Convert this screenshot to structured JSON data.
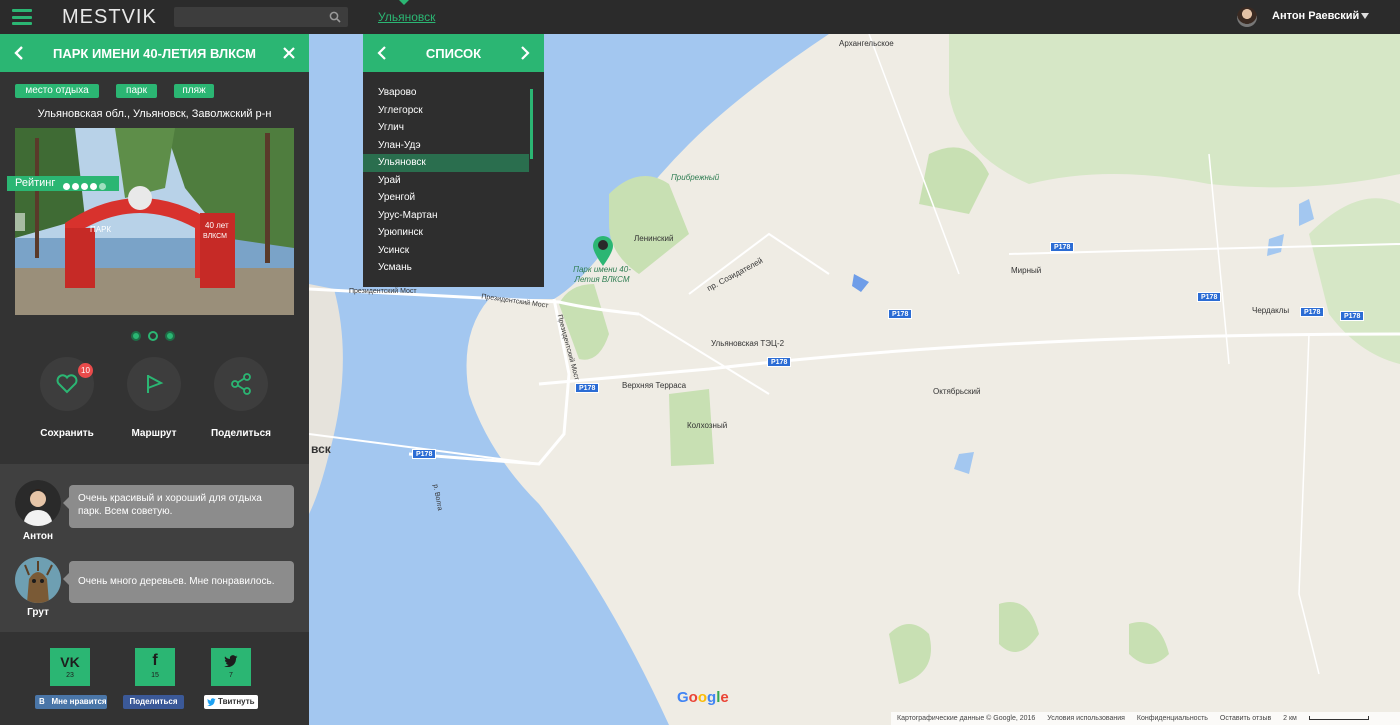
{
  "topbar": {
    "logo_left": "MEST",
    "logo_pin": "O",
    "logo_right": "VIK",
    "search_placeholder": "",
    "city": "Ульяновск",
    "user_name": "Антон Раевский"
  },
  "place": {
    "title": "ПАРК ИМЕНИ 40-ЛЕТИЯ ВЛКСМ",
    "tags": [
      "место отдыха",
      "парк",
      "пляж"
    ],
    "address": "Ульяновская обл., Ульяновск, Заволжский р-н",
    "rating_label": "Рейтинг",
    "rating_value": 4,
    "rating_max": 5,
    "photo_text": [
      "ПАРК",
      "40 лет",
      "ВЛКСМ"
    ],
    "gallery_count": 3,
    "actions": {
      "save": "Сохранить",
      "save_count": "10",
      "route": "Маршрут",
      "share": "Поделиться"
    }
  },
  "comments": [
    {
      "author": "Антон",
      "text": "Очень красивый и хороший для отдыха парк. Всем советую."
    },
    {
      "author": "Грут",
      "text": "Очень много деревьев. Мне понравилось."
    }
  ],
  "social": {
    "vk": {
      "icon": "VK",
      "count": "23",
      "button": "Мне нравится",
      "button_icon": "В"
    },
    "fb": {
      "icon": "f",
      "count": "15",
      "button": "Поделиться"
    },
    "tw": {
      "icon": "🐦",
      "count": "7",
      "button": "Твитнуть"
    }
  },
  "city_list": {
    "title": "СПИСОК",
    "items": [
      "Уварово",
      "Углегорск",
      "Углич",
      "Улан-Удэ",
      "Ульяновск",
      "Урай",
      "Уренгой",
      "Урус-Мартан",
      "Урюпинск",
      "Усинск",
      "Усмань"
    ],
    "selected": "Ульяновск"
  },
  "map": {
    "labels": {
      "arkh": "Архангельское",
      "pribrezh": "Прибрежный",
      "leninsky": "Ленинский",
      "marker": "Парк имени 40-Летия ВЛКСМ",
      "sozidateley": "пр. Созидателей",
      "prez1": "Президентский Мост",
      "prez2": "Президентский Мост",
      "prez3": "Президентский Мост",
      "tec": "Ульяновская ТЭЦ-2",
      "terrasa": "Верхняя Терраса",
      "kolkhozny": "Колхозный",
      "mirny": "Мирный",
      "cherdakly": "Чердаклы",
      "oktyabrsky": "Октябрьский",
      "vsk": "вск",
      "volga": "р. Волга"
    },
    "road": "Р178",
    "attribution": [
      "Картографические данные © Google, 2016",
      "Условия использования",
      "Конфиденциальность",
      "Оставить отзыв",
      "2 км"
    ],
    "google": [
      "G",
      "o",
      "o",
      "g",
      "l",
      "e"
    ],
    "google_colors": [
      "#4285f4",
      "#ea4335",
      "#fbbc05",
      "#4285f4",
      "#34a853",
      "#ea4335"
    ]
  },
  "colors": {
    "accent": "#2bb673",
    "panel": "#333333",
    "water": "#a3c7f0",
    "road_badge": "#2b6cd4"
  }
}
